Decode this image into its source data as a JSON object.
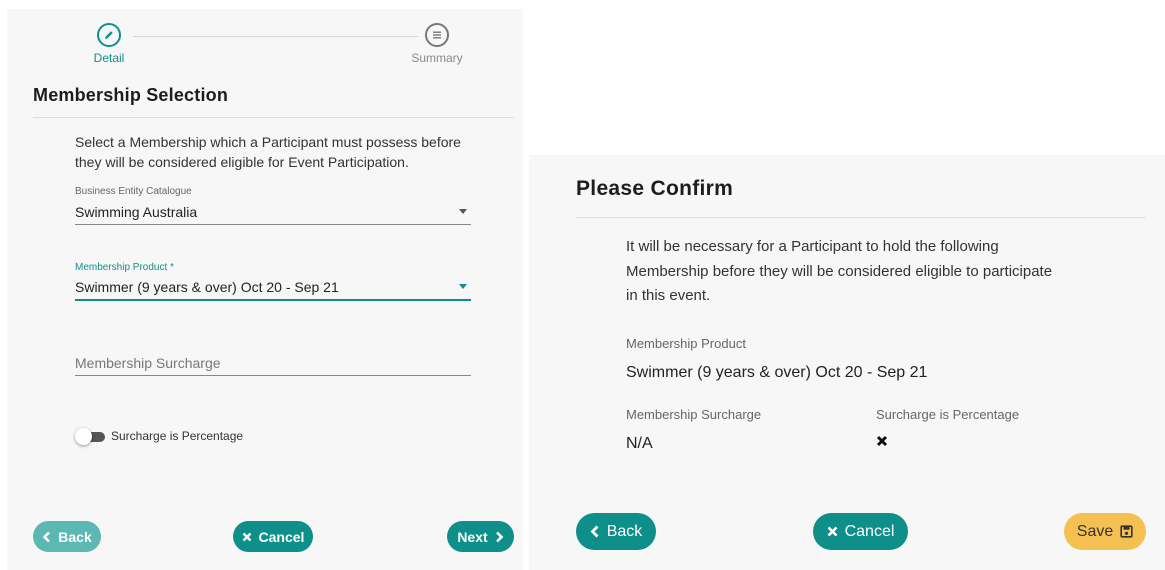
{
  "detail_panel": {
    "steps": [
      {
        "label": "Detail",
        "icon": "pencil-icon"
      },
      {
        "label": "Summary",
        "icon": "list-icon"
      }
    ],
    "title": "Membership Selection",
    "description_line1": "Select a Membership which a Participant must possess before",
    "description_line2": "they will be considered eligible for Event Participation.",
    "catalogue": {
      "label": "Business Entity Catalogue",
      "value": "Swimming Australia"
    },
    "product": {
      "label": "Membership Product *",
      "value": "Swimmer (9 years & over) Oct 20 - Sep 21"
    },
    "surcharge": {
      "placeholder": "Membership Surcharge"
    },
    "percentage_toggle": {
      "label": "Surcharge is Percentage",
      "on": false
    },
    "buttons": {
      "back": "Back",
      "cancel": "Cancel",
      "next": "Next"
    }
  },
  "confirm_panel": {
    "title": "Please Confirm",
    "description_line1": "It will be necessary for a Participant to hold the following",
    "description_line2": "Membership before they will be considered eligible to participate",
    "description_line3": "in this event.",
    "product_label": "Membership Product",
    "product_value": "Swimmer (9 years & over) Oct 20 - Sep 21",
    "surcharge_label": "Membership Surcharge",
    "surcharge_value": "N/A",
    "percentage_label": "Surcharge is Percentage",
    "percentage_icon": "cross-icon",
    "buttons": {
      "back": "Back",
      "cancel": "Cancel",
      "save": "Save"
    }
  },
  "colors": {
    "accent": "#0f8f8a",
    "back_disabled": "#5cb8b3",
    "save": "#f5c052"
  }
}
